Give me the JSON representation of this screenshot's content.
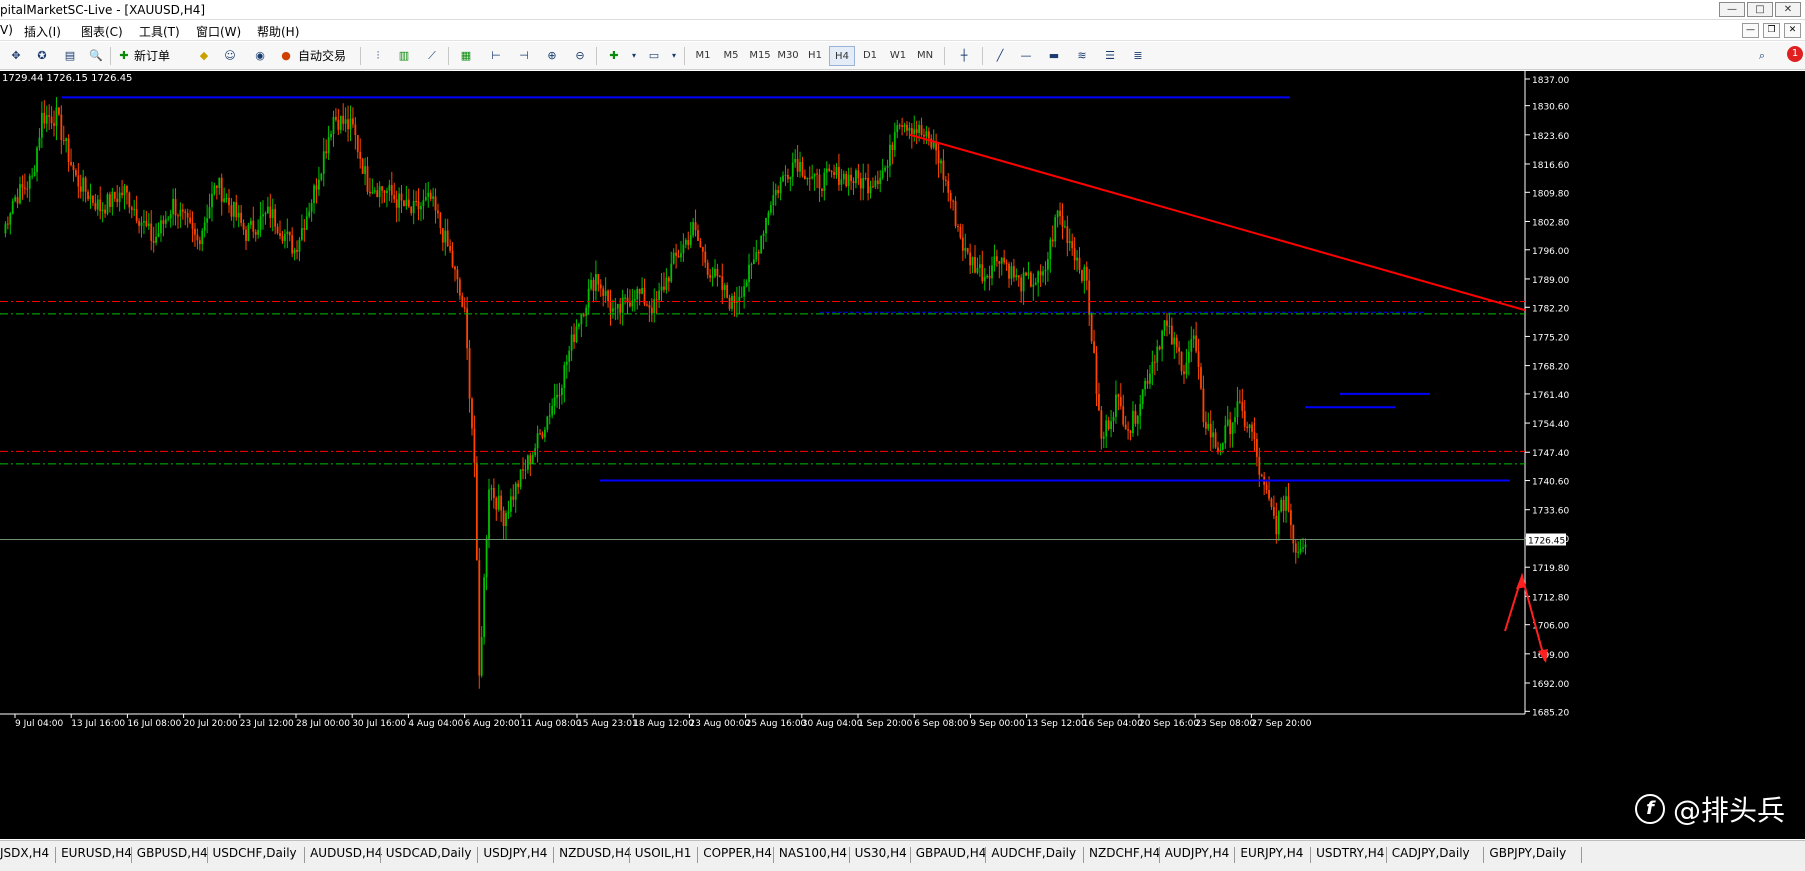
{
  "window": {
    "title": "pitalMarketSC-Live - [XAUUSD,H4]",
    "buttons": [
      "—",
      "□",
      "✕"
    ]
  },
  "menu": {
    "items": [
      "V)",
      "插入(I)",
      "图表(C)",
      "工具(T)",
      "窗口(W)",
      "帮助(H)"
    ],
    "mdi_buttons": [
      "—",
      "❐",
      "✕"
    ]
  },
  "toolbar": {
    "new_order": "新订单",
    "auto_trading": "自动交易",
    "timeframes": [
      "M1",
      "M5",
      "M15",
      "M30",
      "H1",
      "H4",
      "D1",
      "W1",
      "MN"
    ],
    "active_timeframe": "H4",
    "notification_count": "1"
  },
  "chart": {
    "ohlc_readout": "1729.44 1726.15 1726.45",
    "bid_label": "1726.45",
    "price_ticks": [
      "1837.00",
      "1830.60",
      "1823.60",
      "1816.60",
      "1809.80",
      "1802.80",
      "1796.00",
      "1789.00",
      "1782.20",
      "1775.20",
      "1768.20",
      "1761.40",
      "1754.40",
      "1747.40",
      "1740.60",
      "1733.60",
      "1726.80",
      "1719.80",
      "1712.80",
      "1706.00",
      "1699.00",
      "1692.00",
      "1685.20"
    ],
    "time_ticks": [
      "9 Jul 04:00",
      "13 Jul 16:00",
      "16 Jul 08:00",
      "20 Jul 20:00",
      "23 Jul 12:00",
      "28 Jul 00:00",
      "30 Jul 16:00",
      "4 Aug 04:00",
      "6 Aug 20:00",
      "11 Aug 08:00",
      "15 Aug 23:01",
      "18 Aug 12:00",
      "23 Aug 00:00",
      "25 Aug 16:00",
      "30 Aug 04:00",
      "1 Sep 20:00",
      "6 Sep 08:00",
      "9 Sep 00:00",
      "13 Sep 12:00",
      "16 Sep 04:00",
      "20 Sep 16:00",
      "23 Sep 08:00",
      "27 Sep 20:00"
    ],
    "colors": {
      "background": "#000000",
      "bull": "#00c000",
      "bear": "#ff4400",
      "resistance": "#0000ff",
      "trendline": "#ff0000",
      "red_dashed": "#ff0000",
      "green_dashed": "#00c000",
      "text": "#ffffff"
    }
  },
  "chart_data": {
    "type": "candlestick",
    "symbol": "XAUUSD",
    "timeframe": "H4",
    "ylim": [
      1685.2,
      1840.0
    ],
    "last_price": 1726.45,
    "anchors": [
      [
        0,
        1800
      ],
      [
        4,
        1808
      ],
      [
        12,
        1813
      ],
      [
        16,
        1828
      ],
      [
        22,
        1828
      ],
      [
        30,
        1813
      ],
      [
        40,
        1806
      ],
      [
        50,
        1810
      ],
      [
        62,
        1798
      ],
      [
        70,
        1807
      ],
      [
        80,
        1798
      ],
      [
        88,
        1812
      ],
      [
        100,
        1800
      ],
      [
        110,
        1805
      ],
      [
        120,
        1796
      ],
      [
        128,
        1810
      ],
      [
        136,
        1828
      ],
      [
        144,
        1825
      ],
      [
        150,
        1812
      ],
      [
        158,
        1810
      ],
      [
        168,
        1805
      ],
      [
        176,
        1808
      ],
      [
        184,
        1795
      ],
      [
        190,
        1780
      ],
      [
        194,
        1745
      ],
      [
        196,
        1693
      ],
      [
        200,
        1740
      ],
      [
        206,
        1732
      ],
      [
        212,
        1740
      ],
      [
        220,
        1750
      ],
      [
        230,
        1765
      ],
      [
        236,
        1778
      ],
      [
        244,
        1790
      ],
      [
        252,
        1780
      ],
      [
        260,
        1786
      ],
      [
        268,
        1782
      ],
      [
        276,
        1793
      ],
      [
        284,
        1801
      ],
      [
        290,
        1792
      ],
      [
        300,
        1783
      ],
      [
        308,
        1791
      ],
      [
        316,
        1808
      ],
      [
        326,
        1818
      ],
      [
        334,
        1812
      ],
      [
        344,
        1814
      ],
      [
        356,
        1812
      ],
      [
        364,
        1816
      ],
      [
        368,
        1828
      ],
      [
        376,
        1825
      ],
      [
        384,
        1820
      ],
      [
        390,
        1808
      ],
      [
        396,
        1795
      ],
      [
        404,
        1790
      ],
      [
        410,
        1795
      ],
      [
        418,
        1788
      ],
      [
        428,
        1789
      ],
      [
        434,
        1805
      ],
      [
        440,
        1797
      ],
      [
        446,
        1788
      ],
      [
        452,
        1750
      ],
      [
        458,
        1760
      ],
      [
        464,
        1753
      ],
      [
        470,
        1764
      ],
      [
        478,
        1778
      ],
      [
        486,
        1768
      ],
      [
        490,
        1775
      ],
      [
        494,
        1756
      ],
      [
        500,
        1748
      ],
      [
        508,
        1758
      ],
      [
        514,
        1752
      ],
      [
        518,
        1740
      ],
      [
        524,
        1730
      ],
      [
        528,
        1737
      ],
      [
        532,
        1724
      ],
      [
        536,
        1727
      ]
    ],
    "horizontal_lines": [
      {
        "price": 1832.6,
        "style": "solid",
        "color": "blue"
      },
      {
        "price": 1781.0,
        "style": "dashed",
        "color": "blue"
      },
      {
        "price": 1783.6,
        "style": "dashdot",
        "color": "red"
      },
      {
        "price": 1780.6,
        "style": "dashdot",
        "color": "green"
      },
      {
        "price": 1761.4,
        "style": "solid",
        "color": "blue"
      },
      {
        "price": 1758.2,
        "style": "solid",
        "color": "blue"
      },
      {
        "price": 1747.6,
        "style": "dashdot",
        "color": "red"
      },
      {
        "price": 1744.6,
        "style": "dashdot",
        "color": "green"
      },
      {
        "price": 1740.6,
        "style": "solid",
        "color": "blue"
      }
    ],
    "trendline": {
      "from_price": 1823.6,
      "to_price": 1781.5
    }
  },
  "tabs": [
    "JSDX,H4",
    "EURUSD,H4",
    "GBPUSD,H4",
    "USDCHF,Daily",
    "AUDUSD,H4",
    "USDCAD,Daily",
    "USDJPY,H4",
    "NZDUSD,H4",
    "USOIL,H1",
    "COPPER,H4",
    "NAS100,H4",
    "US30,H4",
    "GBPAUD,H4",
    "AUDCHF,Daily",
    "NZDCHF,H4",
    "AUDJPY,H4",
    "EURJPY,H4",
    "USDTRY,H4",
    "CADJPY,Daily",
    "GBPJPY,Daily"
  ],
  "watermark": {
    "logo": "f",
    "text": "@排头兵"
  }
}
